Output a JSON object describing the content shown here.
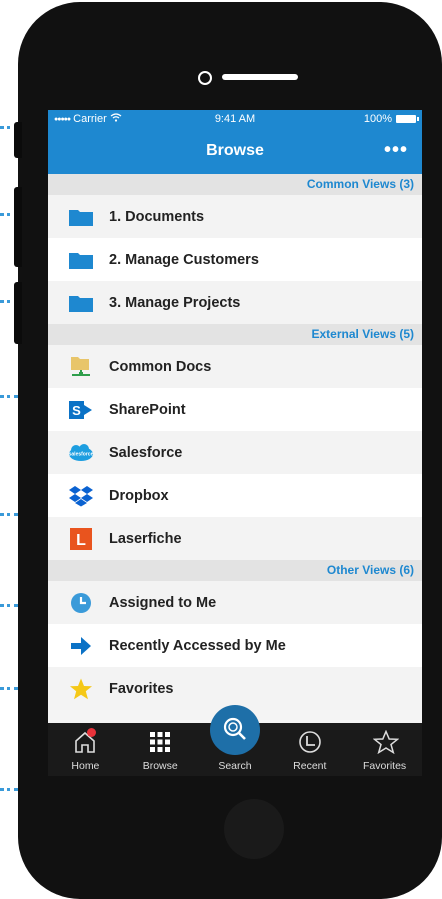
{
  "status_bar": {
    "carrier": "Carrier",
    "time": "9:41 AM",
    "battery": "100%"
  },
  "nav": {
    "title": "Browse",
    "more": "•••"
  },
  "sections": [
    {
      "title": "Common Views (3)",
      "items": [
        {
          "label": "1. Documents",
          "icon": "folder-icon"
        },
        {
          "label": "2. Manage Customers",
          "icon": "folder-icon"
        },
        {
          "label": "3. Manage Projects",
          "icon": "folder-icon"
        }
      ]
    },
    {
      "title": "External Views (5)",
      "items": [
        {
          "label": "Common Docs",
          "icon": "shared-folder-icon"
        },
        {
          "label": "SharePoint",
          "icon": "sharepoint-icon"
        },
        {
          "label": "Salesforce",
          "icon": "salesforce-icon"
        },
        {
          "label": "Dropbox",
          "icon": "dropbox-icon"
        },
        {
          "label": "Laserfiche",
          "icon": "laserfiche-icon"
        }
      ]
    },
    {
      "title": "Other Views (6)",
      "items": [
        {
          "label": "Assigned to Me",
          "icon": "clock-icon"
        },
        {
          "label": "Recently Accessed by Me",
          "icon": "arrow-right-icon"
        },
        {
          "label": "Favorites",
          "icon": "star-icon"
        }
      ]
    }
  ],
  "tabs": [
    {
      "label": "Home",
      "icon": "home-icon"
    },
    {
      "label": "Browse",
      "icon": "grid-icon"
    },
    {
      "label": "Search",
      "icon": "search-icon"
    },
    {
      "label": "Recent",
      "icon": "recent-icon"
    },
    {
      "label": "Favorites",
      "icon": "star-outline-icon"
    }
  ],
  "salesforce_logo_text": "salesforce",
  "laserfiche_logo_text": "L",
  "sharepoint_logo_text": "S",
  "colors": {
    "accent": "#1e88d0",
    "tabbar": "#1a1a1a",
    "search": "#1e6fa8",
    "badge": "#e8323a"
  }
}
